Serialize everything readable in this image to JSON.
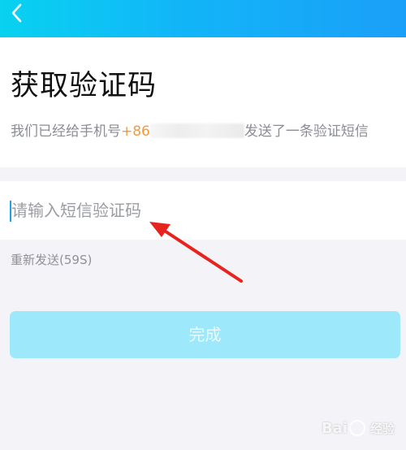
{
  "header": {
    "back_icon": "chevron-left-icon",
    "title": "获取验证码",
    "subtitle_prefix": "我们已经给手机号",
    "country_code": "+86",
    "subtitle_suffix": "发送了一条验证短信"
  },
  "code_input": {
    "placeholder": "请输入短信验证码",
    "value": ""
  },
  "resend": {
    "label": "重新发送(59S)"
  },
  "done_button": {
    "label": "完成"
  },
  "watermark": {
    "brand": "Bai",
    "suffix": "经验"
  },
  "colors": {
    "header_gradient_start": "#08d2f0",
    "header_gradient_end": "#1a9ff8",
    "country_code": "#f29a3a",
    "button_disabled": "#9ee8fb",
    "caret": "#1aa6e6",
    "annotation_arrow": "#e8231d"
  }
}
